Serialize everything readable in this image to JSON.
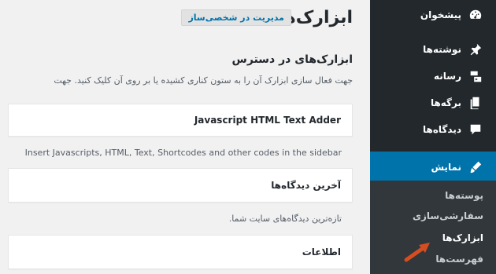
{
  "sidebar": {
    "menu": [
      {
        "label": "پیشخوان",
        "icon": "dashboard-icon"
      },
      {
        "label": "نوشته‌ها",
        "icon": "pin-icon"
      },
      {
        "label": "رسانه",
        "icon": "media-icon"
      },
      {
        "label": "برگه‌ها",
        "icon": "pages-icon"
      },
      {
        "label": "دیدگاه‌ها",
        "icon": "comment-icon"
      },
      {
        "label": "نمایش",
        "icon": "appearance-icon"
      }
    ],
    "submenu": [
      {
        "label": "پوسته‌ها"
      },
      {
        "label": "سفارشی‌سازی"
      },
      {
        "label": "ابزارک‌ها"
      },
      {
        "label": "فهرست‌ها"
      }
    ]
  },
  "main": {
    "page_title": "ابزارک‌ها",
    "manage_button": "مدیریت در شخصی‌ساز",
    "section_title": "ابزارک‌های در دسترس",
    "description": "جهت فعال سازی ابزارک آن را به ستون کناری کشیده یا بر روی آن کلیک کنید. جهت",
    "widgets": [
      {
        "title": "Javascript HTML Text Adder",
        "desc": "Insert Javascripts, HTML, Text, Shortcodes and other codes in the sidebar"
      },
      {
        "title": "آخرین دیدگاه‌ها",
        "desc": "تازه‌ترین دیدگاه‌های سایت شما."
      },
      {
        "title": "اطلاعات",
        "desc": ""
      }
    ]
  },
  "colors": {
    "sidebar_bg": "#23282d",
    "submenu_bg": "#32373c",
    "accent": "#0073aa",
    "pointer_arrow": "#d54e21"
  }
}
